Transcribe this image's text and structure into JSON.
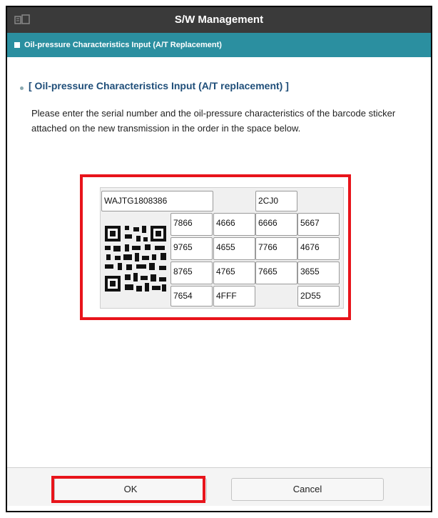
{
  "header": {
    "title": "S/W Management",
    "icon": "home-screen-icon"
  },
  "subheader": {
    "title": "Oil-pressure Characteristics Input (A/T Replacement)"
  },
  "section": {
    "title": "[ Oil-pressure Characteristics Input (A/T replacement) ]",
    "description": "Please enter the serial number and the oil-pressure characteristics of the barcode sticker attached on the new transmission in the order in the space below."
  },
  "form": {
    "serial": "WAJTG1808386",
    "code": "2CJ0",
    "grid": [
      [
        "7866",
        "4666",
        "6666",
        "5667"
      ],
      [
        "9765",
        "4655",
        "7766",
        "4676"
      ],
      [
        "8765",
        "4765",
        "7665",
        "3655"
      ],
      [
        "7654",
        "4FFF",
        "",
        "2D55"
      ]
    ]
  },
  "footer": {
    "ok_label": "OK",
    "cancel_label": "Cancel"
  },
  "colors": {
    "titlebar": "#3a3a3a",
    "subbar": "#2b8fa0",
    "highlight": "#e8141b"
  }
}
